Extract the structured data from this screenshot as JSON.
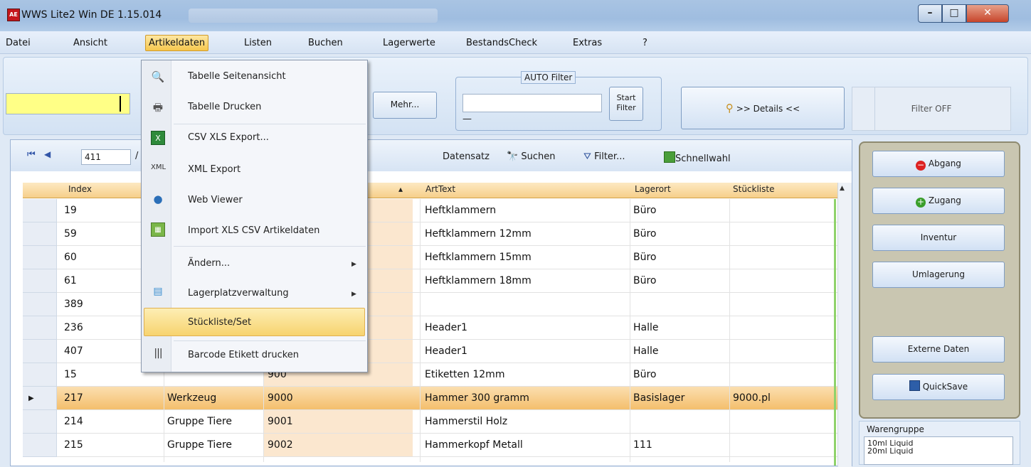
{
  "window": {
    "logo": "AE",
    "title": "WWS Lite2 Win DE 1.15.014",
    "minimize": "–",
    "maximize": "□",
    "close": "✕"
  },
  "menu": [
    "Datei",
    "Ansicht",
    "Artikeldaten",
    "Listen",
    "Buchen",
    "Lagerwerte",
    "BestandsCheck",
    "Extras",
    "?"
  ],
  "toolbar": {
    "mehr": "Mehr...",
    "autofilter_label": "AUTO Filter",
    "start_filter_1": "Start",
    "start_filter_2": "Filter",
    "details": ">> Details <<",
    "filter_off": "Filter OFF",
    "dash": "—"
  },
  "navigator": {
    "position": "411",
    "slash": "/",
    "datensatz": "Datensatz",
    "suchen": "Suchen",
    "filter": "Filter...",
    "schnellwahl": "Schnellwahl"
  },
  "grid": {
    "headers": {
      "index": "Index",
      "arttext": "ArtText",
      "lagerort": "Lagerort",
      "stueckliste": "Stückliste"
    },
    "rows": [
      {
        "index": "19",
        "gruppe": "",
        "nr": "",
        "text": "Heftklammern",
        "lager": "Büro",
        "stk": ""
      },
      {
        "index": "59",
        "gruppe": "",
        "nr": "",
        "text": "Heftklammern 12mm",
        "lager": "Büro",
        "stk": ""
      },
      {
        "index": "60",
        "gruppe": "",
        "nr": "",
        "text": "Heftklammern 15mm",
        "lager": "Büro",
        "stk": ""
      },
      {
        "index": "61",
        "gruppe": "",
        "nr": "",
        "text": "Heftklammern 18mm",
        "lager": "Büro",
        "stk": ""
      },
      {
        "index": "389",
        "gruppe": "",
        "nr": "",
        "text": "",
        "lager": "",
        "stk": ""
      },
      {
        "index": "236",
        "gruppe": "",
        "nr": "",
        "text": "Header1",
        "lager": "Halle",
        "stk": ""
      },
      {
        "index": "407",
        "gruppe": "",
        "nr": "",
        "text": "Header1",
        "lager": "Halle",
        "stk": ""
      },
      {
        "index": "15",
        "gruppe": "",
        "nr": "900",
        "text": "Etiketten 12mm",
        "lager": "Büro",
        "stk": ""
      },
      {
        "index": "217",
        "gruppe": "Werkzeug",
        "nr": "9000",
        "text": "Hammer 300 gramm",
        "lager": "Basislager",
        "stk": "9000.pl"
      },
      {
        "index": "214",
        "gruppe": "Gruppe Tiere",
        "nr": "9001",
        "text": "Hammerstil Holz",
        "lager": "",
        "stk": ""
      },
      {
        "index": "215",
        "gruppe": "Gruppe Tiere",
        "nr": "9002",
        "text": "Hammerkopf Metall",
        "lager": "111",
        "stk": ""
      }
    ]
  },
  "side_buttons": {
    "abgang": "Abgang",
    "zugang": "Zugang",
    "inventur": "Inventur",
    "umlagerung": "Umlagerung",
    "externe_daten": "Externe Daten",
    "quicksave": "QuickSave"
  },
  "warengruppe": {
    "label": "Warengruppe",
    "item1": "10ml Liquid",
    "item2": "20ml Liquid"
  },
  "dropdown": {
    "items": [
      "Tabelle Seitenansicht",
      "Tabelle Drucken",
      "CSV XLS Export...",
      "XML Export",
      "Web Viewer",
      "Import XLS CSV Artikeldaten",
      "Ändern...",
      "Lagerplatzverwaltung",
      "Stückliste/Set",
      "Barcode Etikett drucken"
    ],
    "xml_icon": "XML"
  }
}
